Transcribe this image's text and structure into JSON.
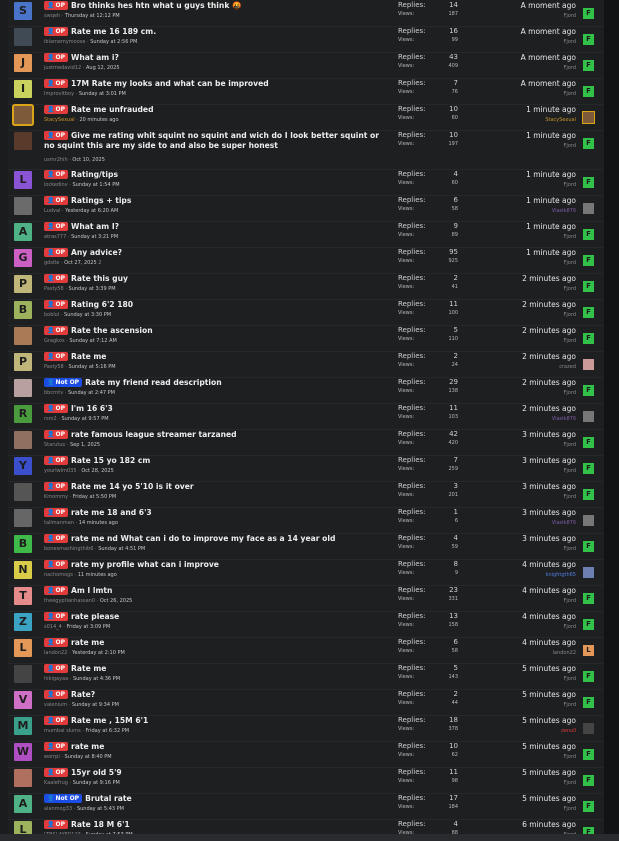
{
  "labels": {
    "replies": "Replies:",
    "views": "Views:",
    "op": "OP",
    "not_op": "Not OP"
  },
  "rows": [
    {
      "ava": "S",
      "ava_color": "#4a74c9",
      "badge": "op",
      "title": "Bro thinks hes htn what u guys think",
      "emoji": "🤬",
      "user": "swqeh",
      "when": "Thursday at 12:12 PM",
      "replies": "14",
      "views": "187",
      "last_time": "A moment ago",
      "last_user": "Fjord",
      "last_user_color": "",
      "ava2": "F",
      "ava2_color": "#32c24a"
    },
    {
      "ava": "",
      "ava_color": "#404a55",
      "ava_photo": true,
      "badge": "op",
      "title": "Rate me 16 189 cm.",
      "user": "iblamemymoose",
      "when": "Sunday at 2:56 PM",
      "replies": "16",
      "views": "99",
      "last_time": "A moment ago",
      "last_user": "Fjord",
      "ava2": "F",
      "ava2_color": "#32c24a"
    },
    {
      "ava": "J",
      "ava_color": "#e39858",
      "badge": "op",
      "title": "What am i?",
      "user": "justmedavid12",
      "when": "Aug 12, 2025",
      "replies": "43",
      "views": "409",
      "last_time": "A moment ago",
      "last_user": "Fjord",
      "ava2": "F",
      "ava2_color": "#32c24a"
    },
    {
      "ava": "I",
      "ava_color": "#c9d25c",
      "badge": "op",
      "title": "17M Rate my looks and what can be improved",
      "user": "Improvitboy",
      "when": "Sunday at 3:01 PM",
      "replies": "7",
      "views": "76",
      "last_time": "A moment ago",
      "last_user": "Fjord",
      "ava2": "F",
      "ava2_color": "#32c24a"
    },
    {
      "ava": "",
      "ava_color": "#7c5a3a",
      "ava_photo": true,
      "ava_gold": true,
      "badge": "op",
      "title": "Rate me unfrauded",
      "user": "StacySexual",
      "user_class": "gold",
      "when": "20 minutes ago",
      "replies": "10",
      "views": "60",
      "last_time": "1 minute ago",
      "last_user": "StacySexual",
      "last_user_class": "gold",
      "ava2": "",
      "ava2_color": "#7c5a3a",
      "ava2_photo": true,
      "ava2_gold": true
    },
    {
      "ava": "",
      "ava_color": "#5a3a2a",
      "ava_photo": true,
      "badge": "op",
      "tall": true,
      "title": "Give me rating whit squint no squint and wich do I look better squint or no squint this are my side to and also be super honest",
      "user": "usmr2hih",
      "when": "Oct 10, 2025",
      "replies": "10",
      "views": "197",
      "last_time": "1 minute ago",
      "last_user": "Fjord",
      "ava2": "F",
      "ava2_color": "#32c24a"
    },
    {
      "ava": "L",
      "ava_color": "#8a54d6",
      "badge": "op",
      "title": "Rating/tips",
      "user": "lockedinv",
      "when": "Sunday at 1:54 PM",
      "replies": "4",
      "views": "60",
      "last_time": "1 minute ago",
      "last_user": "Fjord",
      "ava2": "F",
      "ava2_color": "#32c24a"
    },
    {
      "ava": "",
      "ava_color": "#6b6b6b",
      "ava_photo": true,
      "badge": "op",
      "title": "Ratings + tips",
      "user": "Ludval",
      "when": "Yesterday at 6:20 AM",
      "replies": "6",
      "views": "58",
      "last_time": "1 minute ago",
      "last_user": "Vlasik876",
      "last_user_class": "purple",
      "ava2": "",
      "ava2_color": "#777",
      "ava2_photo": true
    },
    {
      "ava": "A",
      "ava_color": "#4fb287",
      "badge": "op",
      "title": "What am I?",
      "user": "atras777",
      "when": "Sunday at 3:21 PM",
      "replies": "9",
      "views": "89",
      "last_time": "1 minute ago",
      "last_user": "Fjord",
      "ava2": "F",
      "ava2_color": "#32c24a"
    },
    {
      "ava": "G",
      "ava_color": "#cc5fc4",
      "badge": "op",
      "title": "Any advice?",
      "user": "gdstle",
      "when": "Oct 27, 2025",
      "pages": "2",
      "replies": "95",
      "views": "925",
      "last_time": "1 minute ago",
      "last_user": "Fjord",
      "ava2": "F",
      "ava2_color": "#32c24a"
    },
    {
      "ava": "P",
      "ava_color": "#c1b67a",
      "badge": "op",
      "title": "Rate this guy",
      "user": "Pasty58",
      "when": "Sunday at 3:39 PM",
      "replies": "2",
      "views": "41",
      "last_time": "2 minutes ago",
      "last_user": "Fjord",
      "ava2": "F",
      "ava2_color": "#32c24a"
    },
    {
      "ava": "B",
      "ava_color": "#9cb25c",
      "badge": "op",
      "title": "Rating 6'2 180",
      "user": "boblol",
      "when": "Sunday at 3:30 PM",
      "replies": "11",
      "views": "100",
      "last_time": "2 minutes ago",
      "last_user": "Fjord",
      "ava2": "F",
      "ava2_color": "#32c24a"
    },
    {
      "ava": "",
      "ava_color": "#a97a55",
      "ava_photo": true,
      "badge": "op",
      "title": "Rate the ascension",
      "user": "Gragkos",
      "when": "Sunday at 7:12 AM",
      "replies": "5",
      "views": "110",
      "last_time": "2 minutes ago",
      "last_user": "Fjord",
      "ava2": "F",
      "ava2_color": "#32c24a"
    },
    {
      "ava": "P",
      "ava_color": "#c1b67a",
      "badge": "op",
      "title": "Rate me",
      "user": "Pasty58",
      "when": "Sunday at 5:16 PM",
      "replies": "2",
      "views": "24",
      "last_time": "2 minutes ago",
      "last_user": "crazed",
      "ava2": "",
      "ava2_color": "#c99",
      "ava2_photo": true
    },
    {
      "ava": "",
      "ava_color": "#b8a0a0",
      "ava_photo": true,
      "badge": "notop",
      "title": "Rate my friend read description",
      "user": "bbcrntv",
      "when": "Sunday at 2:47 PM",
      "replies": "29",
      "views": "138",
      "last_time": "2 minutes ago",
      "last_user": "Fjord",
      "ava2": "F",
      "ava2_color": "#32c24a"
    },
    {
      "ava": "R",
      "ava_color": "#4a9a3e",
      "badge": "op",
      "title": "I'm 16 6'3",
      "user": "rsm2",
      "when": "Sunday at 9:57 PM",
      "replies": "11",
      "views": "103",
      "last_time": "2 minutes ago",
      "last_user": "Vlasik876",
      "last_user_class": "purple",
      "ava2": "",
      "ava2_color": "#777",
      "ava2_photo": true
    },
    {
      "ava": "",
      "ava_color": "#907060",
      "ava_photo": true,
      "badge": "op",
      "title": "rate famous league streamer tarzaned",
      "user": "Starutus",
      "when": "Sep 1, 2025",
      "replies": "42",
      "views": "420",
      "last_time": "3 minutes ago",
      "last_user": "Fjord",
      "ava2": "F",
      "ava2_color": "#32c24a"
    },
    {
      "ava": "Y",
      "ava_color": "#3b4fcc",
      "badge": "op",
      "title": "Rate 15 yo 182 cm",
      "user": "yourlwlm035",
      "when": "Oct 28, 2025",
      "replies": "7",
      "views": "259",
      "last_time": "3 minutes ago",
      "last_user": "Fjord",
      "ava2": "F",
      "ava2_color": "#32c24a"
    },
    {
      "ava": "",
      "ava_color": "#555",
      "ava_photo": true,
      "badge": "op",
      "title": "Rate me 14 yo 5'10 is it over",
      "user": "Kmommy",
      "when": "Friday at 5:50 PM",
      "replies": "3",
      "views": "201",
      "last_time": "3 minutes ago",
      "last_user": "Fjord",
      "ava2": "F",
      "ava2_color": "#32c24a"
    },
    {
      "ava": "",
      "ava_color": "#666",
      "ava_photo": true,
      "badge": "op",
      "title": "rate me 18 and 6'3",
      "user": "tallmanman",
      "when": "14 minutes ago",
      "replies": "1",
      "views": "6",
      "last_time": "3 minutes ago",
      "last_user": "Vlasik876",
      "last_user_class": "purple",
      "ava2": "",
      "ava2_color": "#777",
      "ava2_photo": true
    },
    {
      "ava": "B",
      "ava_color": "#3fba4a",
      "badge": "op",
      "title": "rate me nd What can i do to improve my face as a 14 year old",
      "user": "bonesmashingthib6",
      "when": "Sunday at 4:51 PM",
      "replies": "4",
      "views": "59",
      "last_time": "3 minutes ago",
      "last_user": "Fjord",
      "ava2": "F",
      "ava2_color": "#32c24a"
    },
    {
      "ava": "N",
      "ava_color": "#d8cc48",
      "badge": "op",
      "title": "rate my profile what can i improve",
      "user": "nachomogs",
      "when": "11 minutes ago",
      "replies": "8",
      "views": "9",
      "last_time": "4 minutes ago",
      "last_user": "knightgth65",
      "last_user_class": "blue",
      "ava2": "",
      "ava2_color": "#6b7fb0",
      "ava2_photo": true
    },
    {
      "ava": "T",
      "ava_color": "#e58b8b",
      "badge": "op",
      "title": "Am I lmtn",
      "user": "theegyptianhassan0",
      "when": "Oct 26, 2025",
      "replies": "23",
      "views": "331",
      "last_time": "4 minutes ago",
      "last_user": "Fjord",
      "ava2": "F",
      "ava2_color": "#32c24a"
    },
    {
      "ava": "Z",
      "ava_color": "#3ba3c4",
      "badge": "op",
      "title": "rate please",
      "user": "s014_4",
      "when": "Friday at 3:09 PM",
      "replies": "13",
      "views": "158",
      "last_time": "4 minutes ago",
      "last_user": "Fjord",
      "ava2": "F",
      "ava2_color": "#32c24a"
    },
    {
      "ava": "L",
      "ava_color": "#e39858",
      "badge": "op",
      "title": "rate me",
      "user": "landon22",
      "when": "Yesterday at 2:10 PM",
      "replies": "6",
      "views": "58",
      "last_time": "4 minutes ago",
      "last_user": "landon22",
      "ava2": "L",
      "ava2_color": "#e39858"
    },
    {
      "ava": "",
      "ava_color": "#444",
      "ava_photo": true,
      "badge": "op",
      "title": "Rate me",
      "user": "hikigayaa",
      "when": "Sunday at 4:36 PM",
      "replies": "5",
      "views": "143",
      "last_time": "5 minutes ago",
      "last_user": "Fjord",
      "ava2": "F",
      "ava2_color": "#32c24a"
    },
    {
      "ava": "V",
      "ava_color": "#d06fc6",
      "badge": "op",
      "title": "Rate?",
      "user": "valenium",
      "when": "Sunday at 9:34 PM",
      "replies": "2",
      "views": "44",
      "last_time": "5 minutes ago",
      "last_user": "Fjord",
      "ava2": "F",
      "ava2_color": "#32c24a"
    },
    {
      "ava": "M",
      "ava_color": "#3aa08a",
      "badge": "op",
      "title": "Rate me , 15M 6'1",
      "user": "mumbai slums",
      "when": "Friday at 6:32 PM",
      "replies": "18",
      "views": "378",
      "last_time": "5 minutes ago",
      "last_user": "zenull",
      "last_user_class": "red",
      "ava2": "",
      "ava2_color": "#444",
      "ava2_photo": true
    },
    {
      "ava": "W",
      "ava_color": "#b04fc4",
      "badge": "op",
      "title": "rate me",
      "user": "worrpl",
      "when": "Sunday at 8:40 PM",
      "replies": "10",
      "views": "62",
      "last_time": "5 minutes ago",
      "last_user": "Fjord",
      "ava2": "F",
      "ava2_color": "#32c24a"
    },
    {
      "ava": "",
      "ava_color": "#b07060",
      "ava_photo": true,
      "badge": "op",
      "title": "15yr old 5'9",
      "user": "Kaalefrug",
      "when": "Sunday at 9:16 PM",
      "replies": "11",
      "views": "98",
      "last_time": "5 minutes ago",
      "last_user": "Fjord",
      "ava2": "F",
      "ava2_color": "#32c24a"
    },
    {
      "ava": "A",
      "ava_color": "#4fb287",
      "badge": "notop",
      "title": "Brutal rate",
      "user": "alanmog33",
      "when": "Sunday at 5:43 PM",
      "replies": "17",
      "views": "184",
      "last_time": "5 minutes ago",
      "last_user": "Fjord",
      "ava2": "F",
      "ava2_color": "#32c24a"
    },
    {
      "ava": "L",
      "ava_color": "#9cb25c",
      "badge": "op",
      "title": "Rate 18 M 6'1",
      "user": "LTBSLAYER123",
      "when": "Sunday at 7:53 PM",
      "replies": "4",
      "views": "88",
      "last_time": "6 minutes ago",
      "last_user": "Fjord",
      "ava2": "F",
      "ava2_color": "#32c24a"
    }
  ]
}
